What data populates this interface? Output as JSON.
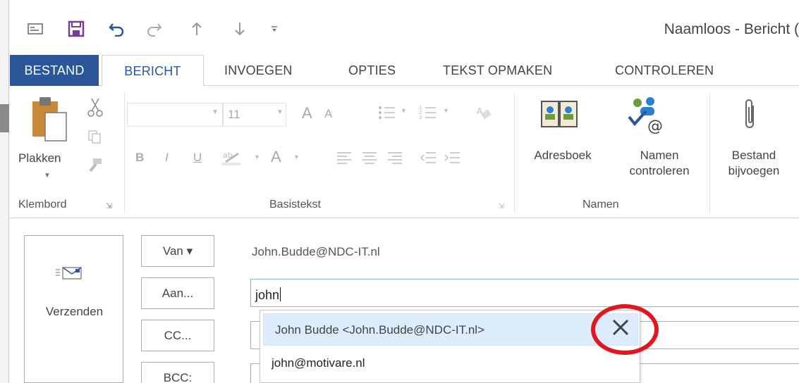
{
  "window": {
    "title": "Naamloos - Bericht ("
  },
  "qat": {
    "icons": [
      "message-icon",
      "save-icon",
      "undo-icon",
      "redo-icon",
      "up-arrow-icon",
      "down-arrow-icon",
      "customize-icon"
    ]
  },
  "tabs": {
    "file": "BESTAND",
    "items": [
      "BERICHT",
      "INVOEGEN",
      "OPTIES",
      "TEKST OPMAKEN",
      "CONTROLEREN"
    ],
    "active": "BERICHT"
  },
  "ribbon": {
    "clipboard": {
      "paste": "Plakken",
      "group": "Klembord"
    },
    "basic_text": {
      "font_size": "11",
      "bold": "B",
      "italic": "I",
      "underline": "U",
      "font_color_letter": "A",
      "grow": "A",
      "shrink": "A",
      "group": "Basistekst"
    },
    "names": {
      "address_book": "Adresboek",
      "check_names_1": "Namen",
      "check_names_2": "controleren",
      "group": "Namen"
    },
    "include": {
      "attach_1": "Bestand",
      "attach_2": "bijvoegen"
    }
  },
  "header": {
    "send": "Verzenden",
    "from_btn": "Van ▾",
    "to_btn": "Aan...",
    "cc_btn": "CC...",
    "bcc_btn": "BCC:",
    "from_value": "John.Budde@NDC-IT.nl",
    "to_value": "john"
  },
  "autocomplete": {
    "items": [
      "John Budde <John.Budde@NDC-IT.nl>",
      "john@motivare.nl"
    ],
    "selected_index": 0
  },
  "colors": {
    "accent": "#2b579a",
    "highlight": "#dcecfc",
    "annotation": "#e3161d"
  }
}
